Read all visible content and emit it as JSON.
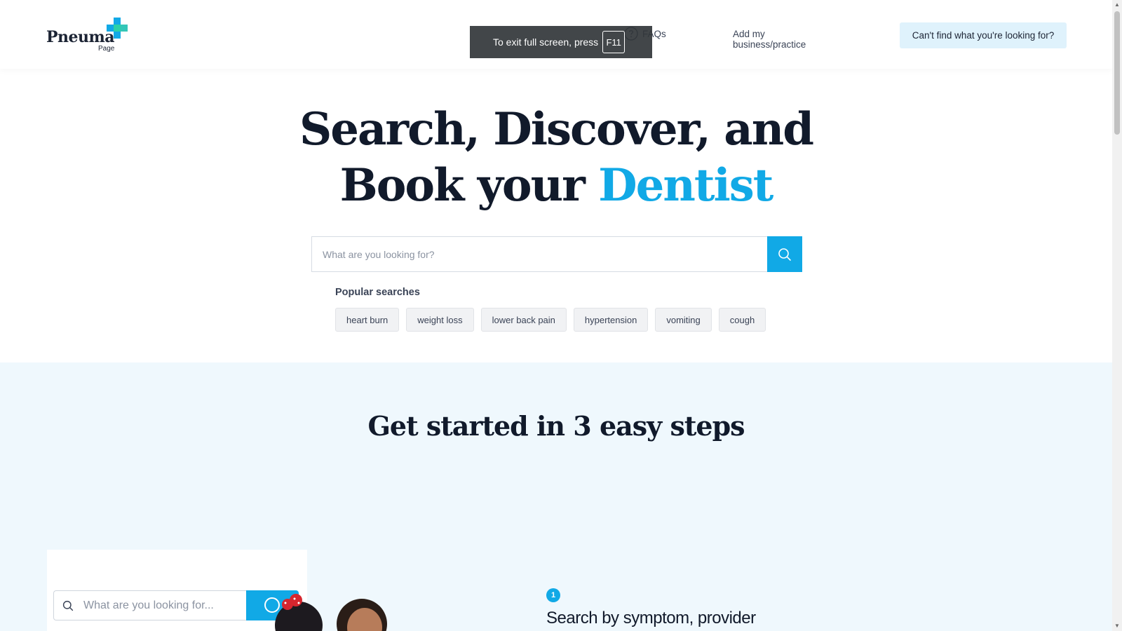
{
  "header": {
    "logo": {
      "name": "Pneuma",
      "sub": "Page"
    },
    "nav": {
      "faqs": "FAQs",
      "add_business": "Add my business/practice",
      "cta": "Can't find what you're looking for?"
    },
    "fullscreen_toast": {
      "text": "To exit full screen, press",
      "key": "F11"
    }
  },
  "hero": {
    "title_line1": "Search, Discover, and",
    "title_line2_prefix": "Book your",
    "title_line2_accent": "Dentist",
    "search_placeholder": "What are you looking for?",
    "popular_label": "Popular searches",
    "popular_searches": [
      "heart burn",
      "weight loss",
      "lower back pain",
      "hypertension",
      "vomiting",
      "cough"
    ]
  },
  "steps": {
    "title": "Get started in 3 easy steps",
    "illustration_search_placeholder": "What are you looking for...",
    "first_step": {
      "number": "1",
      "title": "Search by symptom, provider"
    }
  },
  "colors": {
    "accent": "#11a9e6",
    "heading": "#111a2b",
    "steps_bg": "#eff8fd",
    "cta_bg": "#dff2fc"
  }
}
